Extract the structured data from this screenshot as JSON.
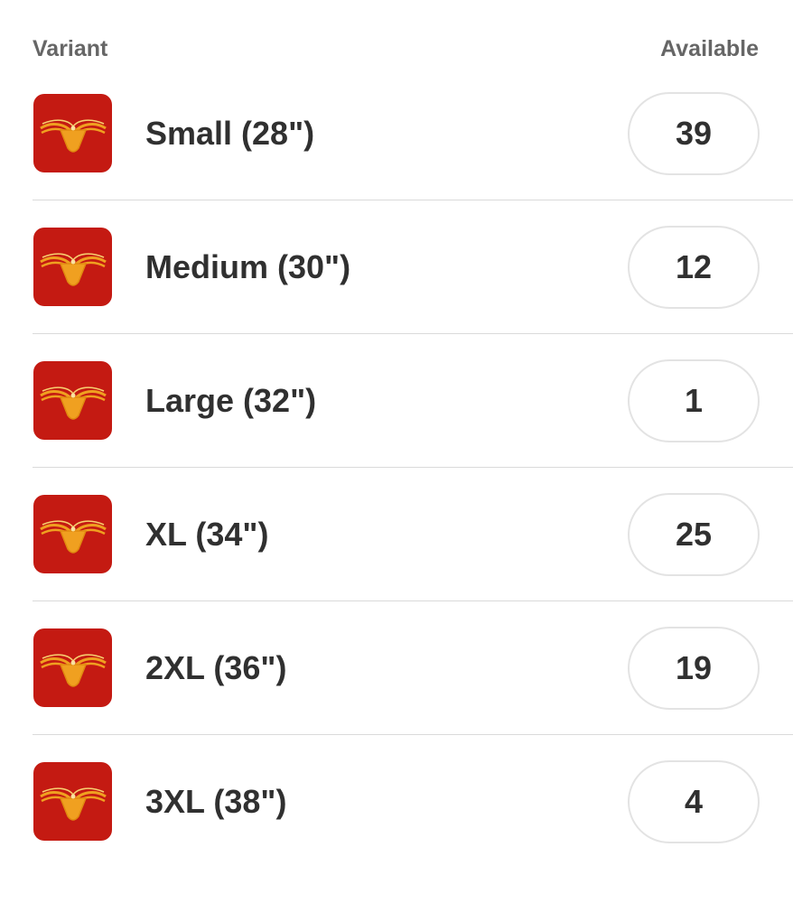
{
  "header": {
    "variant_label": "Variant",
    "available_label": "Available"
  },
  "colors": {
    "thumbnail_background": "#c41a12",
    "product_color": "#f0a020",
    "divider": "#dadada",
    "quantity_border": "#e3e3e3"
  },
  "variants": [
    {
      "name": "Small (28\")",
      "available": "39",
      "icon": "product-thumbnail"
    },
    {
      "name": "Medium (30\")",
      "available": "12",
      "icon": "product-thumbnail"
    },
    {
      "name": "Large (32\")",
      "available": "1",
      "icon": "product-thumbnail"
    },
    {
      "name": "XL (34\")",
      "available": "25",
      "icon": "product-thumbnail"
    },
    {
      "name": "2XL (36\")",
      "available": "19",
      "icon": "product-thumbnail"
    },
    {
      "name": "3XL (38\")",
      "available": "4",
      "icon": "product-thumbnail"
    }
  ]
}
